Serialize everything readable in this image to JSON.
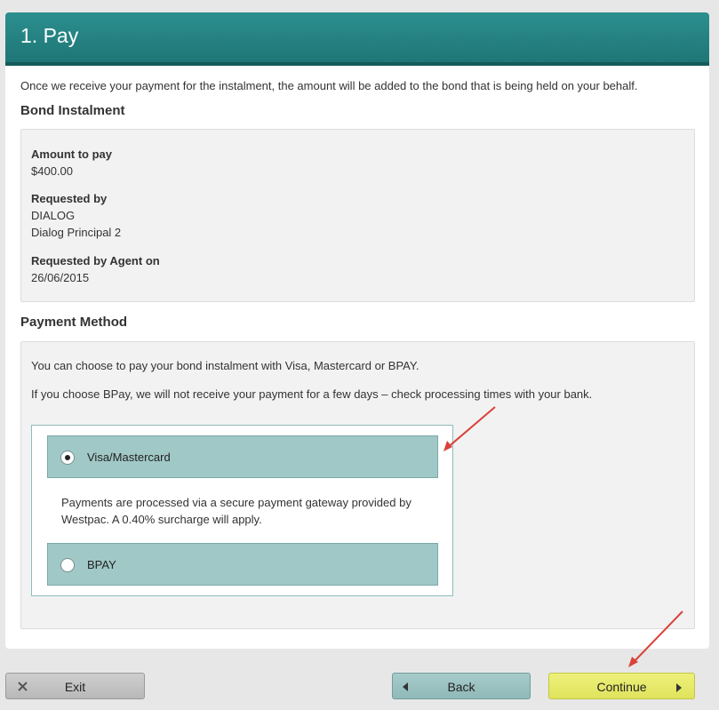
{
  "header": {
    "title": "1. Pay"
  },
  "intro_text": "Once we receive your payment for the instalment, the amount will be added to the bond that is being held on your behalf.",
  "bond": {
    "title": "Bond Instalment",
    "amount_label": "Amount to pay",
    "amount_value": "$400.00",
    "requested_by_label": "Requested by",
    "requested_by_line1": "DIALOG",
    "requested_by_line2": "Dialog Principal 2",
    "requested_on_label": "Requested by Agent on",
    "requested_on_value": "26/06/2015"
  },
  "payment": {
    "title": "Payment Method",
    "text1": "You can choose to pay your bond instalment with Visa, Mastercard or BPAY.",
    "text2": "If you choose BPay, we will not receive your payment for a few days – check processing times with your bank.",
    "options": [
      {
        "label": "Visa/Mastercard",
        "selected": true
      },
      {
        "label": "BPAY",
        "selected": false
      }
    ],
    "visa_description": "Payments are processed via a secure payment gateway provided by Westpac. A 0.40% surcharge will apply."
  },
  "footer": {
    "exit_label": "Exit",
    "back_label": "Back",
    "continue_label": "Continue"
  },
  "colors": {
    "header": "#1f7676",
    "option_bg": "#a0c8c7",
    "continue_bg": "#dfe35c",
    "annotation_arrow": "#d9423a"
  }
}
